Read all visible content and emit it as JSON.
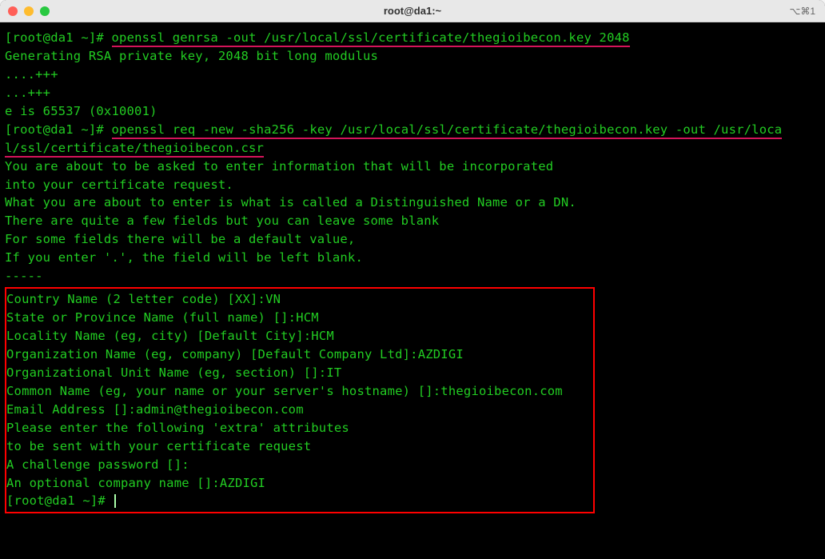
{
  "titlebar": {
    "title": "root@da1:~",
    "right_indicator": "⌥⌘1"
  },
  "prompt": {
    "open": "[",
    "userhost": "root@da1 ~",
    "close": "]#"
  },
  "cmd1": "openssl genrsa -out /usr/local/ssl/certificate/thegioibecon.key 2048",
  "out1": {
    "l1": "Generating RSA private key, 2048 bit long modulus",
    "l2": "....+++",
    "l3": "...+++",
    "l4": "e is 65537 (0x10001)"
  },
  "cmd2a": "openssl req -new -sha256 -key /usr/local/ssl/certificate/thegioibecon.key -out /usr/loca",
  "cmd2b": "l/ssl/certificate/thegioibecon.csr",
  "out2": {
    "l1": "You are about to be asked to enter information that will be incorporated",
    "l2": "into your certificate request.",
    "l3": "What you are about to enter is what is called a Distinguished Name or a DN.",
    "l4": "There are quite a few fields but you can leave some blank",
    "l5": "For some fields there will be a default value,",
    "l6": "If you enter '.', the field will be left blank.",
    "l7": "-----"
  },
  "boxed": {
    "l1": "Country Name (2 letter code) [XX]:VN",
    "l2": "State or Province Name (full name) []:HCM",
    "l3": "Locality Name (eg, city) [Default City]:HCM",
    "l4": "Organization Name (eg, company) [Default Company Ltd]:AZDIGI",
    "l5": "Organizational Unit Name (eg, section) []:IT",
    "l6": "Common Name (eg, your name or your server's hostname) []:thegioibecon.com",
    "l7": "Email Address []:admin@thegioibecon.com",
    "l8": "",
    "l9": "Please enter the following 'extra' attributes",
    "l10": "to be sent with your certificate request",
    "l11": "A challenge password []:",
    "l12": "An optional company name []:AZDIGI"
  }
}
